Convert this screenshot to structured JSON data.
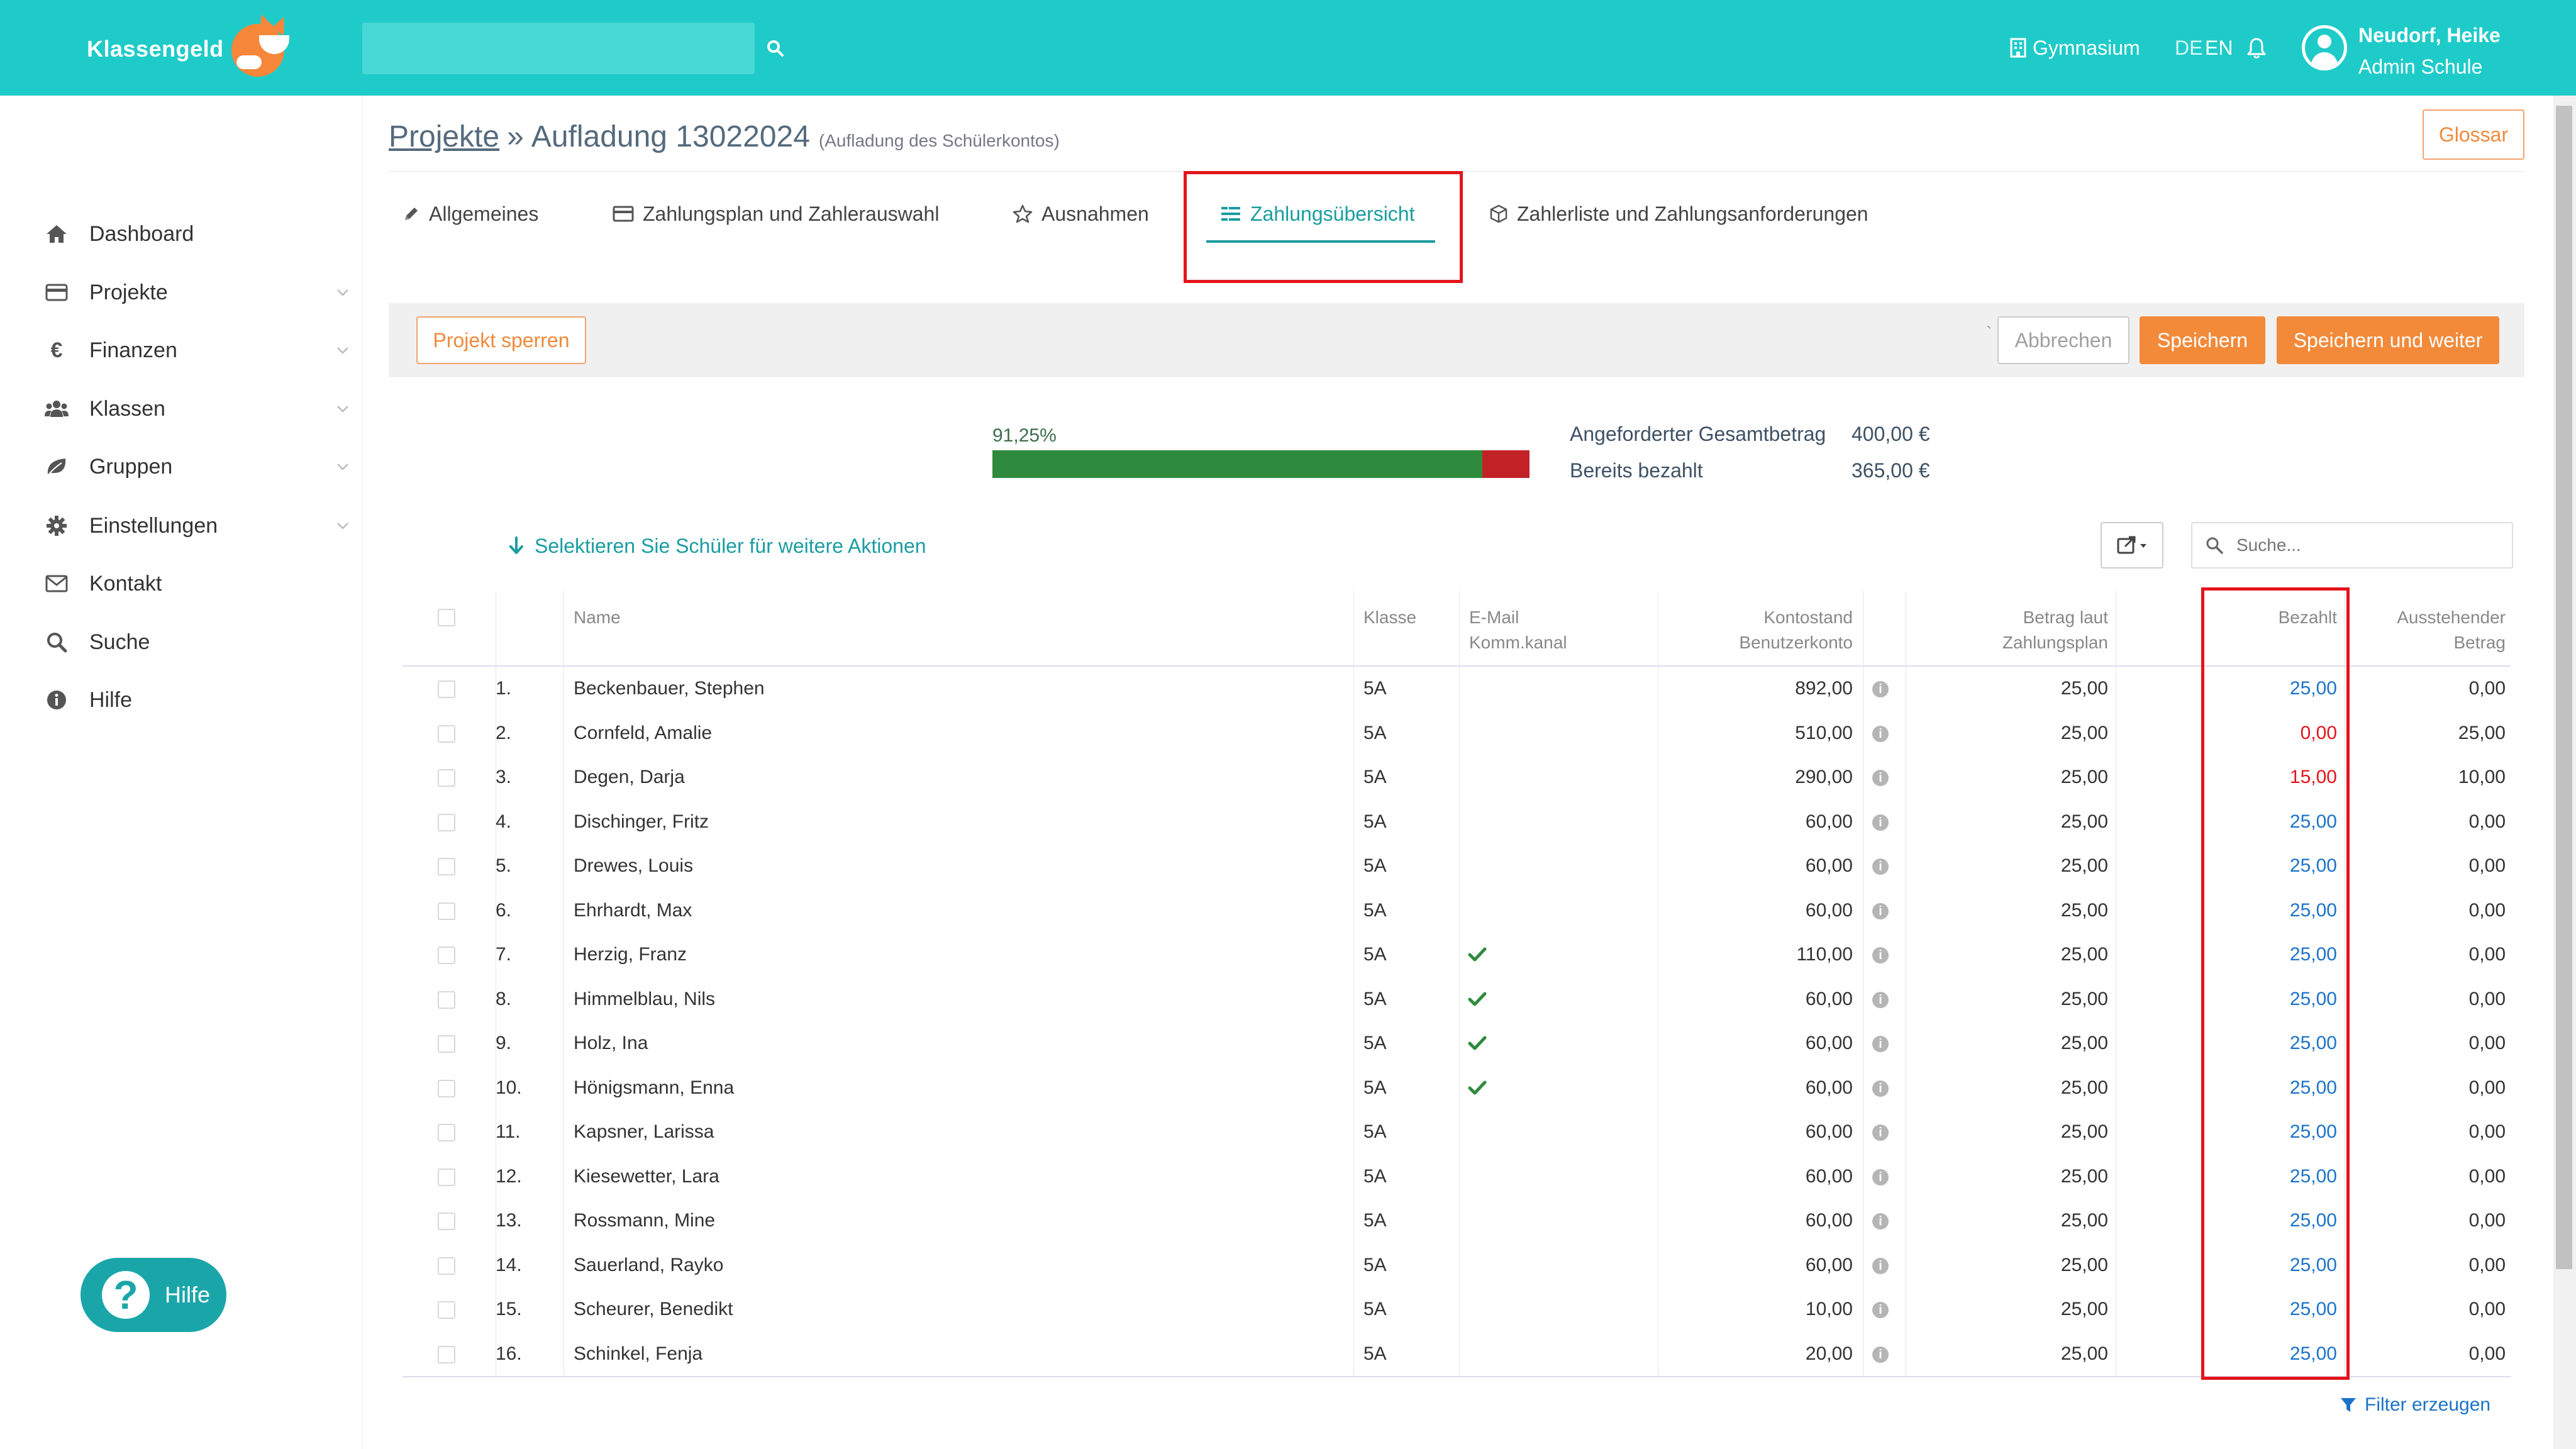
{
  "app": {
    "name": "Klassengeld"
  },
  "top": {
    "search_placeholder": "",
    "school": "Gymnasium",
    "lang_de": "DE",
    "lang_en": "EN",
    "user_name": "Neudorf, Heike",
    "user_role": "Admin Schule"
  },
  "sidebar": {
    "items": [
      {
        "label": "Dashboard",
        "icon": "home-icon"
      },
      {
        "label": "Projekte",
        "icon": "card-icon"
      },
      {
        "label": "Finanzen",
        "icon": "euro-icon"
      },
      {
        "label": "Klassen",
        "icon": "users-icon"
      },
      {
        "label": "Gruppen",
        "icon": "leaf-icon"
      },
      {
        "label": "Einstellungen",
        "icon": "gear-icon"
      },
      {
        "label": "Kontakt",
        "icon": "envelope-icon"
      },
      {
        "label": "Suche",
        "icon": "search-icon"
      },
      {
        "label": "Hilfe",
        "icon": "info-icon"
      }
    ],
    "help_button": "Hilfe"
  },
  "breadcrumb": {
    "root": "Projekte",
    "sep": "»",
    "current": "Aufladung 13022024",
    "sub": "(Aufladung des Schülerkontos)"
  },
  "glossar": "Glossar",
  "tabs": [
    {
      "label": "Allgemeines"
    },
    {
      "label": "Zahlungsplan und Zahlerauswahl"
    },
    {
      "label": "Ausnahmen"
    },
    {
      "label": "Zahlungsübersicht"
    },
    {
      "label": "Zahlerliste und Zahlungsanforderungen"
    }
  ],
  "actions": {
    "lock": "Projekt sperren",
    "tick": "`",
    "cancel": "Abbrechen",
    "save": "Speichern",
    "save_next": "Speichern und weiter"
  },
  "summary": {
    "percent_label": "91,25%",
    "paid_fraction": 0.9125,
    "requested_label": "Angeforderter Gesamtbetrag",
    "requested_value": "400,00 €",
    "paid_label": "Bereits bezahlt",
    "paid_value": "365,00 €"
  },
  "select_hint": "Selektieren Sie Schüler für weitere Aktionen",
  "table_search_placeholder": "Suche...",
  "table": {
    "headers": {
      "name": "Name",
      "klasse": "Klasse",
      "email_1": "E-Mail",
      "email_2": "Komm.kanal",
      "konto_1": "Kontostand",
      "konto_2": "Benutzerkonto",
      "plan_1": "Betrag laut",
      "plan_2": "Zahlungsplan",
      "bezahlt": "Bezahlt",
      "offen_1": "Ausstehender",
      "offen_2": "Betrag"
    },
    "rows": [
      {
        "nr": "1.",
        "name": "Beckenbauer, Stephen",
        "klasse": "5A",
        "email": false,
        "konto": "892,00",
        "plan": "25,00",
        "bezahlt": "25,00",
        "paid_status": "full",
        "offen": "0,00"
      },
      {
        "nr": "2.",
        "name": "Cornfeld, Amalie",
        "klasse": "5A",
        "email": false,
        "konto": "510,00",
        "plan": "25,00",
        "bezahlt": "0,00",
        "paid_status": "partial",
        "offen": "25,00"
      },
      {
        "nr": "3.",
        "name": "Degen, Darja",
        "klasse": "5A",
        "email": false,
        "konto": "290,00",
        "plan": "25,00",
        "bezahlt": "15,00",
        "paid_status": "partial",
        "offen": "10,00"
      },
      {
        "nr": "4.",
        "name": "Dischinger, Fritz",
        "klasse": "5A",
        "email": false,
        "konto": "60,00",
        "plan": "25,00",
        "bezahlt": "25,00",
        "paid_status": "full",
        "offen": "0,00"
      },
      {
        "nr": "5.",
        "name": "Drewes, Louis",
        "klasse": "5A",
        "email": false,
        "konto": "60,00",
        "plan": "25,00",
        "bezahlt": "25,00",
        "paid_status": "full",
        "offen": "0,00"
      },
      {
        "nr": "6.",
        "name": "Ehrhardt, Max",
        "klasse": "5A",
        "email": false,
        "konto": "60,00",
        "plan": "25,00",
        "bezahlt": "25,00",
        "paid_status": "full",
        "offen": "0,00"
      },
      {
        "nr": "7.",
        "name": "Herzig, Franz",
        "klasse": "5A",
        "email": true,
        "konto": "110,00",
        "plan": "25,00",
        "bezahlt": "25,00",
        "paid_status": "full",
        "offen": "0,00"
      },
      {
        "nr": "8.",
        "name": "Himmelblau, Nils",
        "klasse": "5A",
        "email": true,
        "konto": "60,00",
        "plan": "25,00",
        "bezahlt": "25,00",
        "paid_status": "full",
        "offen": "0,00"
      },
      {
        "nr": "9.",
        "name": "Holz, Ina",
        "klasse": "5A",
        "email": true,
        "konto": "60,00",
        "plan": "25,00",
        "bezahlt": "25,00",
        "paid_status": "full",
        "offen": "0,00"
      },
      {
        "nr": "10.",
        "name": "Hönigsmann, Enna",
        "klasse": "5A",
        "email": true,
        "konto": "60,00",
        "plan": "25,00",
        "bezahlt": "25,00",
        "paid_status": "full",
        "offen": "0,00"
      },
      {
        "nr": "11.",
        "name": "Kapsner, Larissa",
        "klasse": "5A",
        "email": false,
        "konto": "60,00",
        "plan": "25,00",
        "bezahlt": "25,00",
        "paid_status": "full",
        "offen": "0,00"
      },
      {
        "nr": "12.",
        "name": "Kiesewetter, Lara",
        "klasse": "5A",
        "email": false,
        "konto": "60,00",
        "plan": "25,00",
        "bezahlt": "25,00",
        "paid_status": "full",
        "offen": "0,00"
      },
      {
        "nr": "13.",
        "name": "Rossmann, Mine",
        "klasse": "5A",
        "email": false,
        "konto": "60,00",
        "plan": "25,00",
        "bezahlt": "25,00",
        "paid_status": "full",
        "offen": "0,00"
      },
      {
        "nr": "14.",
        "name": "Sauerland, Rayko",
        "klasse": "5A",
        "email": false,
        "konto": "60,00",
        "plan": "25,00",
        "bezahlt": "25,00",
        "paid_status": "full",
        "offen": "0,00"
      },
      {
        "nr": "15.",
        "name": "Scheurer, Benedikt",
        "klasse": "5A",
        "email": false,
        "konto": "10,00",
        "plan": "25,00",
        "bezahlt": "25,00",
        "paid_status": "full",
        "offen": "0,00"
      },
      {
        "nr": "16.",
        "name": "Schinkel, Fenja",
        "klasse": "5A",
        "email": false,
        "konto": "20,00",
        "plan": "25,00",
        "bezahlt": "25,00",
        "paid_status": "full",
        "offen": "0,00"
      }
    ]
  },
  "filter_link": "Filter erzeugen",
  "colors": {
    "teal": "#1fcbc8",
    "accent_teal": "#1b9da0",
    "orange": "#f28a3a",
    "paid_blue": "#1c73c9",
    "unpaid_red": "#e4141b",
    "progress_green": "#2e8a3c",
    "progress_red": "#c22226"
  }
}
